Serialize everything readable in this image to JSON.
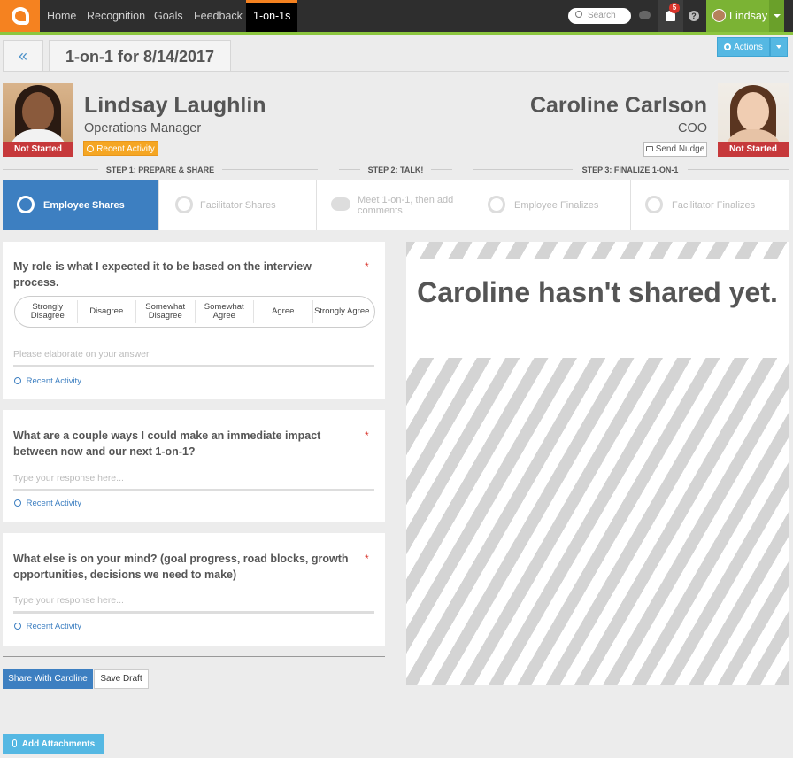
{
  "nav": {
    "items": [
      "Home",
      "Recognition",
      "Goals",
      "Feedback",
      "1-on-1s"
    ],
    "active": "1-on-1s",
    "search_placeholder": "Search",
    "notification_count": "5",
    "help_glyph": "?",
    "user_name": "Lindsay",
    "colors": {
      "bar": "#2e2e2e",
      "logo": "#f58220",
      "accent": "#8cc63f"
    }
  },
  "header": {
    "back_glyph": "«",
    "title": "1-on-1 for 8/14/2017",
    "actions_label": "Actions"
  },
  "employee": {
    "name": "Lindsay Laughlin",
    "role": "Operations Manager",
    "status": "Not Started",
    "recent_activity_label": "Recent Activity"
  },
  "facilitator": {
    "name": "Caroline Carlson",
    "role": "COO",
    "status": "Not Started",
    "send_nudge_label": "Send Nudge"
  },
  "steps": {
    "labels": [
      "STEP 1: PREPARE & SHARE",
      "STEP 2: TALK!",
      "STEP 3: FINALIZE 1-ON-1"
    ],
    "items": [
      "Employee Shares",
      "Facilitator Shares",
      "Meet 1-on-1, then add comments",
      "Employee Finalizes",
      "Facilitator Finalizes"
    ],
    "active_index": 0
  },
  "questions": [
    {
      "text": "My role is what I expected it to be based on the interview process.",
      "required": "*",
      "scale": [
        "Strongly Disagree",
        "Disagree",
        "Somewhat Disagree",
        "Somewhat Agree",
        "Agree",
        "Strongly Agree"
      ],
      "placeholder": "Please elaborate on your answer",
      "recent_activity": "Recent Activity"
    },
    {
      "text": "What are a couple ways I could make an immediate impact between now and our next 1-on-1?",
      "required": "*",
      "placeholder": "Type your response here...",
      "recent_activity": "Recent Activity"
    },
    {
      "text": "What else is on your mind? (goal progress, road blocks, growth opportunities, decisions we need to make)",
      "required": "*",
      "placeholder": "Type your response here...",
      "recent_activity": "Recent Activity"
    }
  ],
  "footer": {
    "share_label": "Share With Caroline",
    "draft_label": "Save Draft",
    "attach_label": "Add Attachments"
  },
  "right_panel": {
    "message": "Caroline hasn't shared yet."
  }
}
